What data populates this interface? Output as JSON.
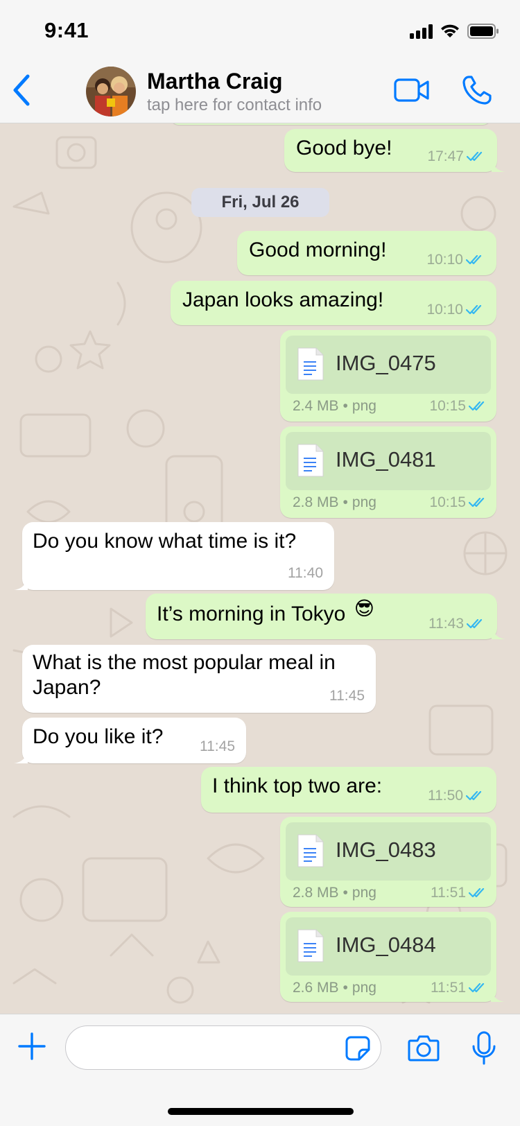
{
  "status_bar": {
    "time": "9:41"
  },
  "header": {
    "contact_name": "Martha Craig",
    "contact_subtitle": "tap here for contact info",
    "icons": {
      "back": "chevron-left-icon",
      "video": "video-camera-icon",
      "call": "phone-icon"
    }
  },
  "colors": {
    "accent": "#007aff",
    "outgoing_bubble": "#dcf8c6",
    "incoming_bubble": "#ffffff",
    "read_ticks": "#34b7f1",
    "wallpaper": "#e6ddd4"
  },
  "chat": {
    "date_separator": "Fri, Jul 26",
    "messages": [
      {
        "direction": "out",
        "text": "Good bye!",
        "time": "17:47",
        "status": "read"
      },
      {
        "direction": "out",
        "text": "Good morning!",
        "time": "10:10",
        "status": "read"
      },
      {
        "direction": "out",
        "text": "Japan looks amazing!",
        "time": "10:10",
        "status": "read"
      },
      {
        "direction": "out",
        "type": "file",
        "file_name": "IMG_0475",
        "size": "2.4 MB",
        "ext": "png",
        "time": "10:15",
        "status": "read"
      },
      {
        "direction": "out",
        "type": "file",
        "file_name": "IMG_0481",
        "size": "2.8 MB",
        "ext": "png",
        "time": "10:15",
        "status": "read"
      },
      {
        "direction": "in",
        "text": "Do you know what time is it?",
        "time": "11:40"
      },
      {
        "direction": "out",
        "text": "It’s morning in Tokyo",
        "emoji": "😎",
        "time": "11:43",
        "status": "read"
      },
      {
        "direction": "in",
        "text_line1": "What is the most popular meal in",
        "text_line2": "Japan?",
        "time": "11:45"
      },
      {
        "direction": "in",
        "text": "Do you like it?",
        "time": "11:45"
      },
      {
        "direction": "out",
        "text": "I think top two are:",
        "time": "11:50",
        "status": "read"
      },
      {
        "direction": "out",
        "type": "file",
        "file_name": "IMG_0483",
        "size": "2.8 MB",
        "ext": "png",
        "time": "11:51",
        "status": "read"
      },
      {
        "direction": "out",
        "type": "file",
        "file_name": "IMG_0484",
        "size": "2.6 MB",
        "ext": "png",
        "time": "11:51",
        "status": "read"
      }
    ]
  },
  "input_bar": {
    "message_value": "",
    "icons": {
      "attach": "plus-icon",
      "sticker": "sticker-icon",
      "camera": "camera-icon",
      "voice": "microphone-icon"
    }
  }
}
